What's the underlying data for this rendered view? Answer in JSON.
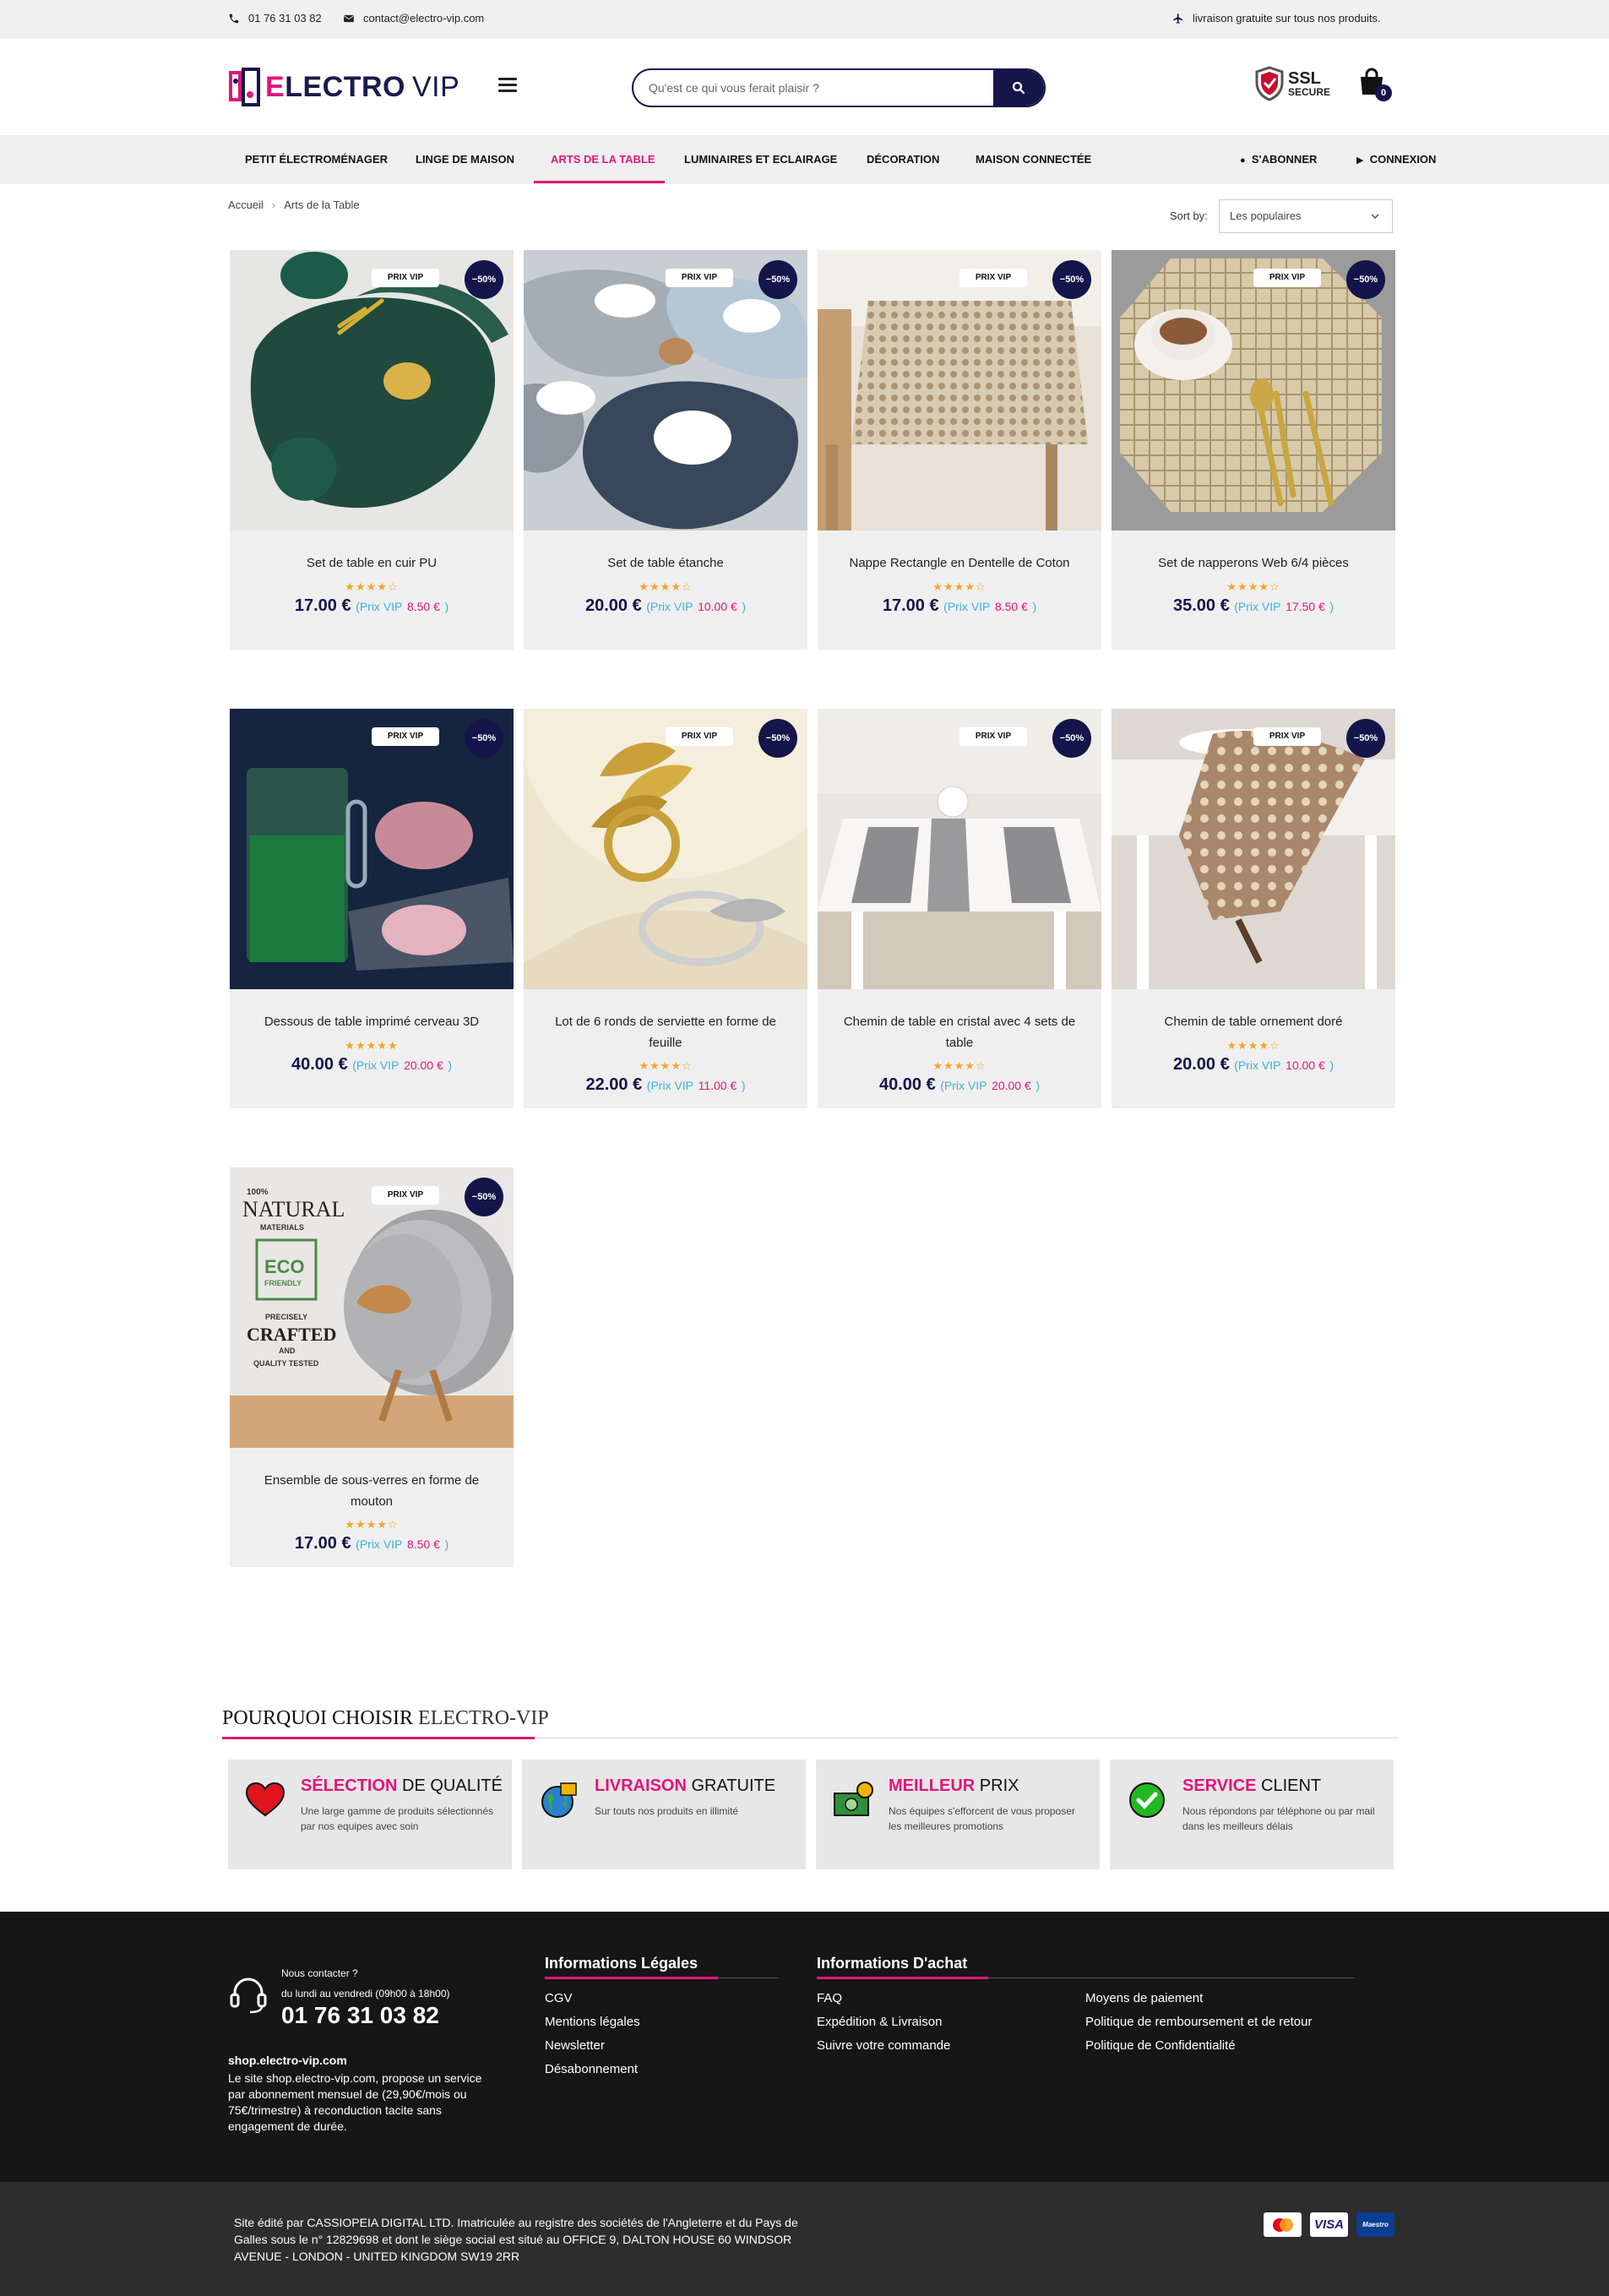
{
  "topbar": {
    "phone": "01 76 31 03 82",
    "email": "contact@electro-vip.com",
    "shipping": "livraison gratuite sur tous nos produits."
  },
  "header": {
    "logo_word_a": "E",
    "logo_word_b": "LECTRO",
    "logo_word_c": "VIP",
    "search_placeholder": "Qu'est ce qui vous ferait plaisir ?",
    "ssl_a": "SSL",
    "ssl_b": "SECURE",
    "cart_count": "0"
  },
  "nav": {
    "items": [
      "PETIT ÉLECTROMÉNAGER",
      "LINGE DE MAISON",
      "ARTS DE LA TABLE",
      "LUMINAIRES ET ECLAIRAGE",
      "DÉCORATION",
      "MAISON CONNECTÉE"
    ],
    "subscribe": "S'ABONNER",
    "login": "CONNEXION"
  },
  "breadcrumb": {
    "home": "Accueil",
    "sep": "›",
    "current": "Arts de la Table"
  },
  "sort": {
    "label": "Sort by:",
    "value": "Les populaires"
  },
  "products": [
    {
      "name": "Set de table en cuir PU",
      "stars": "★★★★☆",
      "price": "17.00 €",
      "vip": "8.50 €",
      "badge": "PRIX VIP",
      "off": "−50%"
    },
    {
      "name": "Set de table étanche",
      "stars": "★★★★☆",
      "price": "20.00 €",
      "vip": "10.00 €",
      "badge": "PRIX VIP",
      "off": "−50%"
    },
    {
      "name": "Nappe Rectangle en Dentelle de Coton",
      "stars": "★★★★☆",
      "price": "17.00 €",
      "vip": "8.50 €",
      "badge": "PRIX VIP",
      "off": "−50%"
    },
    {
      "name": "Set de napperons Web 6/4 pièces",
      "stars": "★★★★☆",
      "price": "35.00 €",
      "vip": "17.50 €",
      "badge": "PRIX VIP",
      "off": "−50%"
    },
    {
      "name": "Dessous de table imprimé cerveau 3D",
      "stars": "★★★★★",
      "price": "40.00 €",
      "vip": "20.00 €",
      "badge": "PRIX VIP",
      "off": "−50%"
    },
    {
      "name": "Lot de 6 ronds de serviette en forme de feuille",
      "stars": "★★★★☆",
      "price": "22.00 €",
      "vip": "11.00 €",
      "badge": "PRIX VIP",
      "off": "−50%"
    },
    {
      "name": "Chemin de table en cristal avec 4 sets de table",
      "stars": "★★★★☆",
      "price": "40.00 €",
      "vip": "20.00 €",
      "badge": "PRIX VIP",
      "off": "−50%"
    },
    {
      "name": "Chemin de table ornement doré",
      "stars": "★★★★☆",
      "price": "20.00 €",
      "vip": "10.00 €",
      "badge": "PRIX VIP",
      "off": "−50%"
    },
    {
      "name": "Ensemble de sous-verres en forme de mouton",
      "stars": "★★★★☆",
      "price": "17.00 €",
      "vip": "8.50 €",
      "badge": "PRIX VIP",
      "off": "−50%"
    }
  ],
  "price_labels": {
    "open": "(Prix VIP",
    "close": ")"
  },
  "product_image_text": {
    "natural_a": "100%",
    "natural_b": "NATURAL",
    "natural_c": "MATERIALS",
    "eco_a": "ECO",
    "eco_b": "FRIENDLY",
    "crafted_a": "PRECISELY",
    "crafted_b": "CRAFTED",
    "crafted_c": "AND",
    "crafted_d": "QUALITY TESTED"
  },
  "why": {
    "title_a": "POURQUOI CHOISIR",
    "title_b": "ELECTRO-VIP",
    "features": [
      {
        "bold": "SÉLECTION",
        "rest": "DE QUALITÉ",
        "desc": "Une large gamme de produits sélectionnés par nos equipes avec soin"
      },
      {
        "bold": "LIVRAISON",
        "rest": "GRATUITE",
        "desc": "Sur touts nos produits en illimité"
      },
      {
        "bold": "MEILLEUR",
        "rest": "PRIX",
        "desc": "Nos équipes s'efforcent de vous proposer les meilleures promotions"
      },
      {
        "bold": "SERVICE",
        "rest": "CLIENT",
        "desc": "Nous répondons par téléphone ou par mail dans les meilleurs délais"
      }
    ]
  },
  "footer": {
    "contact_title": "Nous contacter ?",
    "contact_hours": "du lundi au vendredi (09h00 à 18h00)",
    "contact_phone": "01 76 31 03 82",
    "shop": "shop.electro-vip.com",
    "desc": "Le site shop.electro-vip.com, propose un service par abonnement mensuel de (29,90€/mois ou 75€/trimestre) à reconduction tacite sans engagement de durée.",
    "legal_title": "Informations Légales",
    "legal_links": [
      "CGV",
      "Mentions légales",
      "Newsletter",
      "Désabonnement"
    ],
    "achat_title": "Informations D'achat",
    "achat_links_a": [
      "FAQ",
      "Expédition & Livraison",
      "Suivre votre commande"
    ],
    "achat_links_b": [
      "Moyens de paiement",
      "Politique de remboursement et de retour",
      "Politique de Confidentialité"
    ],
    "bottom_legal": "Site édité par CASSIOPEIA DIGITAL LTD. Imatriculée au registre des sociétés de l'Angleterre et du Pays de Galles sous le n° 12829698 et dont le siège social est situé au OFFICE 9, DALTON HOUSE 60 WINDSOR AVENUE - LONDON - UNITED KINGDOM SW19 2RR",
    "payments": [
      "mastercard",
      "VISA",
      "Maestro"
    ]
  },
  "colors": {
    "accent": "#e0167a",
    "navy": "#14154a",
    "vip_blue": "#3fb0d8",
    "star": "#f5a623"
  }
}
